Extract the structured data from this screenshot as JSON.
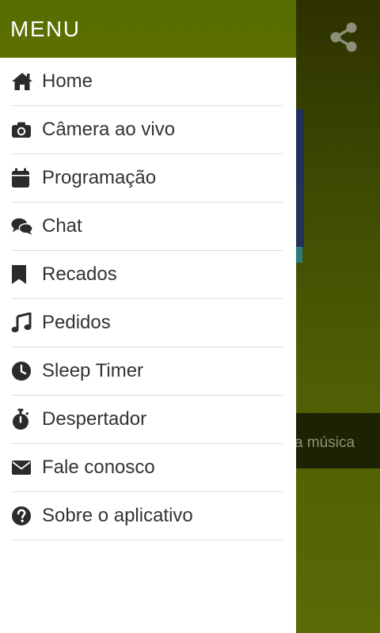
{
  "background": {
    "bar_text": "a música"
  },
  "drawer": {
    "title": "MENU",
    "items": [
      {
        "label": "Home",
        "icon": "home-icon"
      },
      {
        "label": "Câmera ao vivo",
        "icon": "camera-icon"
      },
      {
        "label": "Programação",
        "icon": "calendar-icon"
      },
      {
        "label": "Chat",
        "icon": "chat-icon"
      },
      {
        "label": "Recados",
        "icon": "bookmark-icon"
      },
      {
        "label": "Pedidos",
        "icon": "music-icon"
      },
      {
        "label": "Sleep Timer",
        "icon": "clock-icon"
      },
      {
        "label": "Despertador",
        "icon": "stopwatch-icon"
      },
      {
        "label": "Fale conosco",
        "icon": "envelope-icon"
      },
      {
        "label": "Sobre o aplicativo",
        "icon": "question-icon"
      }
    ]
  },
  "colors": {
    "header_green": "#5d7100",
    "icon_dark": "#2b2b2b",
    "text": "#333333"
  }
}
